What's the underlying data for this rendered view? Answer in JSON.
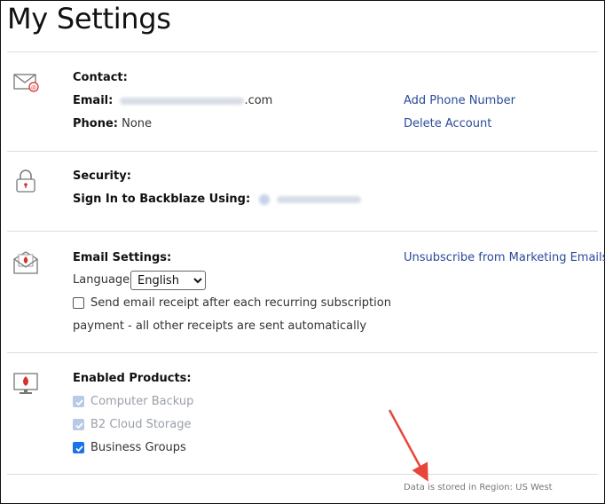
{
  "page": {
    "title": "My Settings"
  },
  "contact": {
    "heading": "Contact:",
    "email_label": "Email:",
    "email_suffix": ".com",
    "phone_label": "Phone:",
    "phone_value": "None",
    "add_phone_link": "Add Phone Number",
    "delete_account_link": "Delete Account"
  },
  "security": {
    "heading": "Security:",
    "sign_in_label": "Sign In to Backblaze Using:"
  },
  "email_settings": {
    "heading": "Email Settings:",
    "unsubscribe_link": "Unsubscribe from Marketing Emails",
    "language_label": "Language:",
    "language_selected": "English",
    "receipt_line1": "Send email receipt after each recurring subscription",
    "receipt_line2": "payment - all other receipts are sent automatically",
    "receipt_checked": false
  },
  "products": {
    "heading": "Enabled Products:",
    "items": [
      {
        "label": "Computer Backup",
        "state": "checked-disabled"
      },
      {
        "label": "B2 Cloud Storage",
        "state": "checked-disabled"
      },
      {
        "label": "Business Groups",
        "state": "checked"
      }
    ]
  },
  "footer": {
    "region_text": "Data is stored in Region: US West"
  },
  "colors": {
    "link": "#2a4a9a",
    "checkbox_on": "#1a73e8",
    "arrow": "#e8463a",
    "icon_red": "#d6312b"
  },
  "annotation": {
    "type": "red-arrow",
    "target": "region-text"
  }
}
